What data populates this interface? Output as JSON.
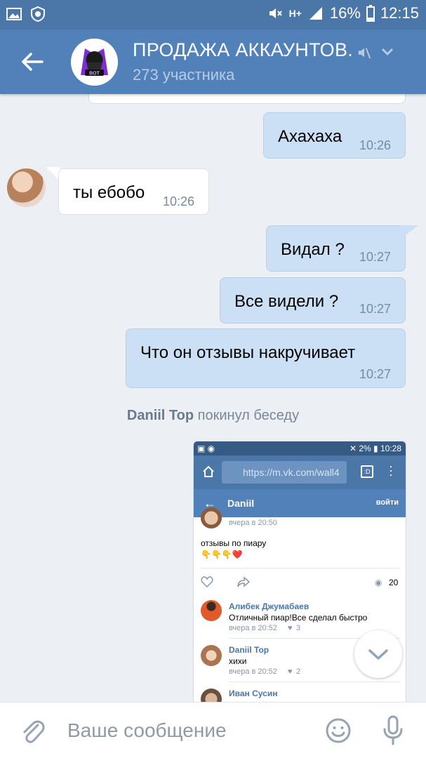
{
  "status_bar": {
    "battery_percent": "16%",
    "time": "12:15",
    "network": "H+",
    "icons": [
      "image-icon",
      "vk-shield-icon",
      "mute-icon",
      "signal-icon",
      "battery-icon"
    ]
  },
  "header": {
    "title": "ПРОДАЖА АККАУНТОВ.",
    "subtitle": "273 участника",
    "avatar_text": "BOT",
    "icons": [
      "back-arrow-icon",
      "mute-icon",
      "chevron-down-icon"
    ]
  },
  "messages": [
    {
      "type": "out",
      "text": "Ахахаха",
      "time": "10:26"
    },
    {
      "type": "in",
      "text": "ты ебобо",
      "time": "10:26"
    },
    {
      "type": "out",
      "text": "Видал ?",
      "time": "10:27"
    },
    {
      "type": "out",
      "text": "Все видели ?",
      "time": "10:27"
    },
    {
      "type": "out",
      "text": "Что он отзывы накручивает",
      "time": "10:27"
    }
  ],
  "system_message": {
    "name": "Daniil Top",
    "action": "покинул беседу"
  },
  "screenshot": {
    "status": {
      "battery": "2%",
      "time": "10:28"
    },
    "url": "https://m.vk.com/wall4",
    "tabs_label": ":D",
    "nav_title": "Daniil",
    "nav_action": "войти",
    "post": {
      "time": "вчера в 20:50",
      "text": "отзывы по пиару",
      "emojis": "👇👇👇❤️",
      "views": "20"
    },
    "comments": [
      {
        "name": "Алибек Джумабаев",
        "text": "Отличный пиар!Все сделал быстро",
        "time": "вчера в 20:52",
        "likes": "3"
      },
      {
        "name": "Daniil Top",
        "text": "хихи",
        "time": "вчера в 20:52",
        "likes": "2"
      },
      {
        "name": "Иван Сусин",
        "text": "",
        "time": "",
        "likes": ""
      }
    ]
  },
  "input": {
    "placeholder": "Ваше сообщение"
  },
  "colors": {
    "header": "#5181b8",
    "status_bar": "#4a76a8",
    "outgoing_bubble": "#cce0f5",
    "background": "#eceff3"
  }
}
